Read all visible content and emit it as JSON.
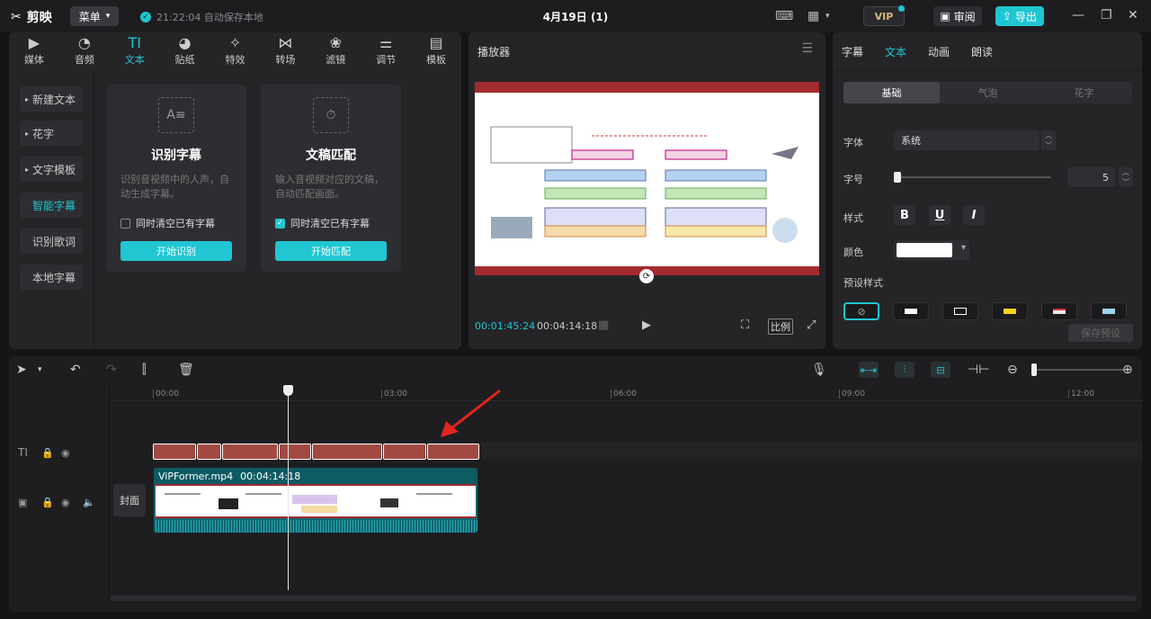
{
  "topbar": {
    "app_name": "剪映",
    "menu_label": "菜单",
    "autosave_text": "21:22:04 自动保存本地",
    "doc_title": "4月19日 (1)",
    "vip_label": "VIP",
    "review_label": "审阅",
    "export_label": "导出"
  },
  "toolbar_tabs": [
    {
      "label": "媒体",
      "icon": "media-icon"
    },
    {
      "label": "音频",
      "icon": "audio-icon"
    },
    {
      "label": "文本",
      "icon": "text-icon"
    },
    {
      "label": "贴纸",
      "icon": "sticker-icon"
    },
    {
      "label": "特效",
      "icon": "effects-icon"
    },
    {
      "label": "转场",
      "icon": "transition-icon"
    },
    {
      "label": "滤镜",
      "icon": "filter-icon"
    },
    {
      "label": "调节",
      "icon": "adjust-icon"
    },
    {
      "label": "模板",
      "icon": "template-icon"
    }
  ],
  "active_tab": "文本",
  "sidebar": {
    "items": [
      {
        "label": "新建文本",
        "arrow": "▸"
      },
      {
        "label": "花字",
        "arrow": "▸"
      },
      {
        "label": "文字模板",
        "arrow": "▸"
      },
      {
        "label": "智能字幕",
        "arrow": ""
      },
      {
        "label": "识别歌词",
        "arrow": ""
      },
      {
        "label": "本地字幕",
        "arrow": ""
      }
    ]
  },
  "cards": [
    {
      "title": "识别字幕",
      "desc": "识别音视频中的人声，自动生成字幕。",
      "checkbox_label": "同时清空已有字幕",
      "checked": false,
      "button": "开始识别"
    },
    {
      "title": "文稿匹配",
      "desc": "输入音视频对应的文稿，自动匹配画面。",
      "checkbox_label": "同时清空已有字幕",
      "checked": true,
      "button": "开始匹配"
    }
  ],
  "player": {
    "title": "播放器",
    "current_time": "00:01:45:24",
    "total_time": "00:04:14:18",
    "ratio_label": "比例"
  },
  "right_panel": {
    "tabs": [
      "字幕",
      "文本",
      "动画",
      "朗读"
    ],
    "active_tab": "文本",
    "segments": [
      "基础",
      "气泡",
      "花字"
    ],
    "font_label": "字体",
    "font_value": "系统",
    "size_label": "字号",
    "size_value": "5",
    "style_label": "样式",
    "style_buttons": [
      "B",
      "U",
      "I"
    ],
    "color_label": "颜色",
    "color_value": "#ffffff",
    "preset_label": "预设样式",
    "save_preset_label": "保存预设"
  },
  "timeline": {
    "ruler_ticks": [
      "00:00",
      "03:00",
      "06:00",
      "09:00",
      "12:00"
    ],
    "cover_label": "封面",
    "clip_name": "ViPFormer.mp4",
    "clip_duration": "00:04:14:18"
  },
  "colors": {
    "accent": "#20c6d2",
    "subtitle_clip": "#a24a42",
    "video_clip": "#0e6770"
  }
}
